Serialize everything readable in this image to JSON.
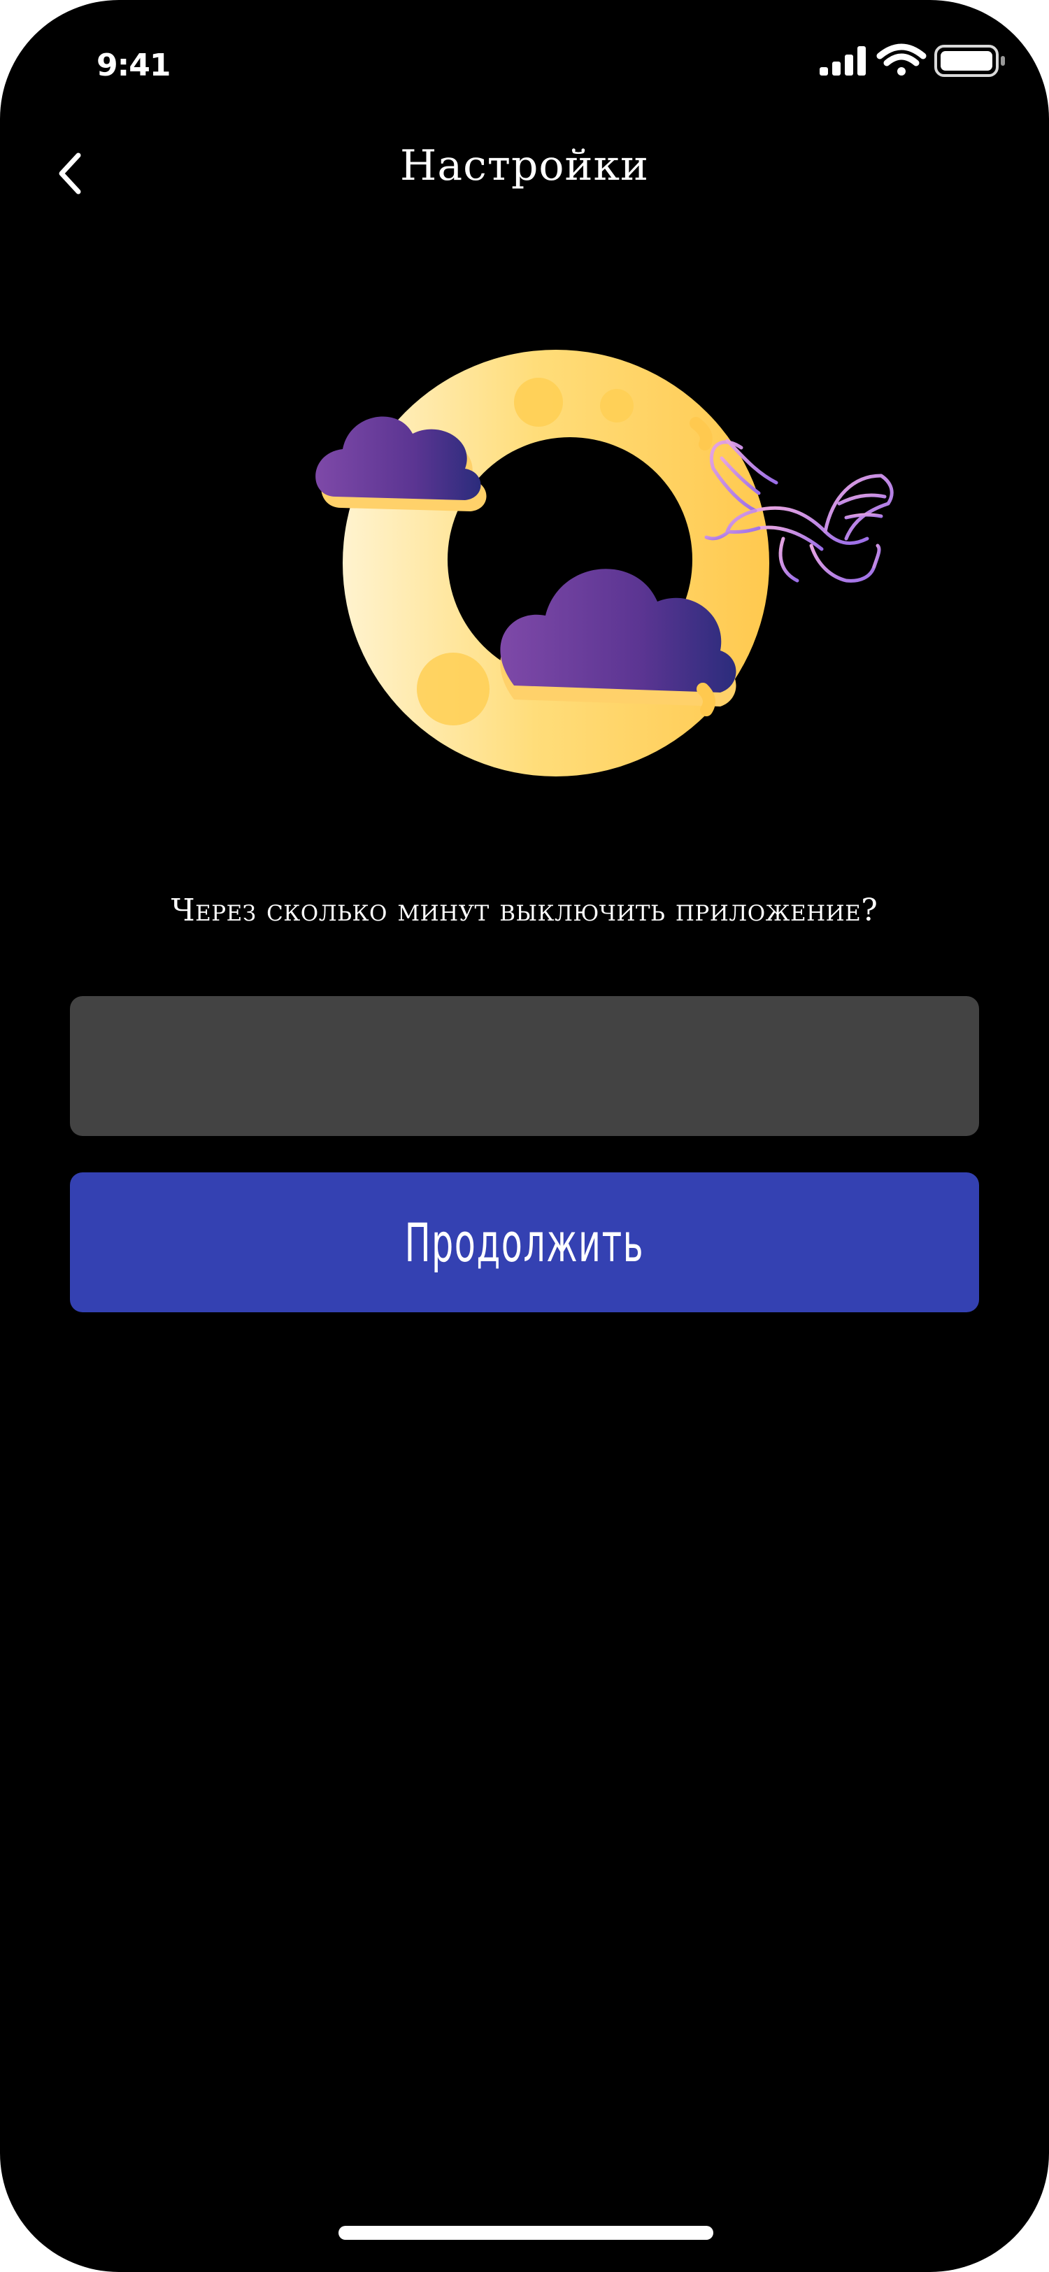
{
  "status_bar": {
    "time": "9:41",
    "icons": [
      "cellular-signal-icon",
      "wifi-icon",
      "battery-icon"
    ]
  },
  "nav": {
    "title": "Настройки",
    "back_icon": "chevron-left-icon"
  },
  "hero": {
    "illustration": "moon-clouds-dragon-illustration"
  },
  "form": {
    "question": "Через сколько минут выключить приложение?",
    "input_value": "",
    "input_placeholder": ""
  },
  "actions": {
    "continue_label": "Продолжить"
  },
  "colors": {
    "background": "#000000",
    "input_background": "#434343",
    "button_background": "#3441b2",
    "moon": "#ffd460",
    "cloud": "#6e3c99",
    "dragon": "#b57fe0"
  }
}
